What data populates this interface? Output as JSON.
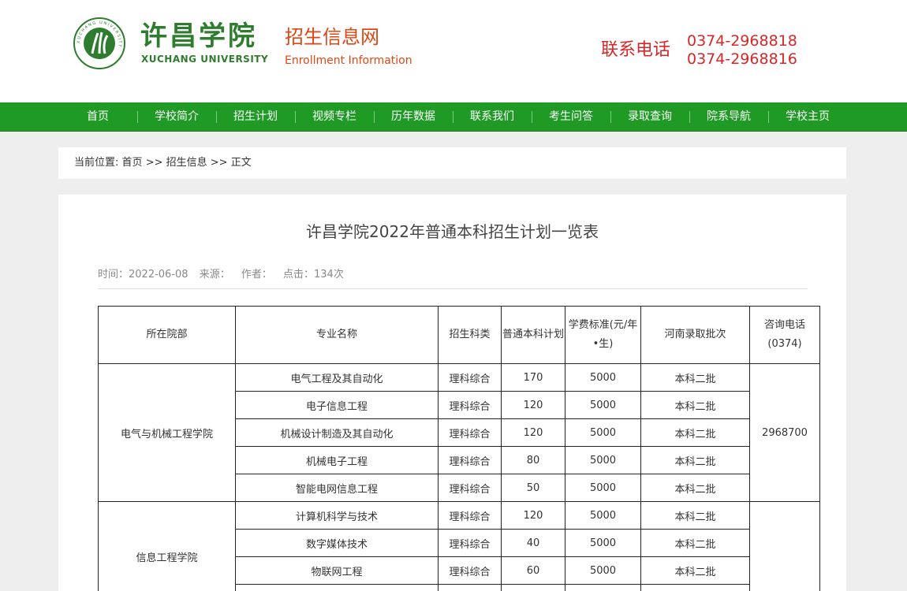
{
  "header": {
    "school_name_cn": "许昌学院",
    "school_name_en": "XUCHANG UNIVERSITY",
    "seal_text": "XUCHANG UNIVERSITY",
    "site_name_cn": "招生信息网",
    "site_name_en": "Enrollment Information",
    "contact_label": "联系电话",
    "phones": [
      "0374-2968818",
      "0374-2968816"
    ]
  },
  "nav": {
    "items": [
      "首页",
      "学校简介",
      "招生计划",
      "视频专栏",
      "历年数据",
      "联系我们",
      "考生问答",
      "录取查询",
      "院系导航",
      "学校主页"
    ]
  },
  "breadcrumb": {
    "prefix": "当前位置:",
    "items": [
      "首页",
      "招生信息",
      "正文"
    ],
    "separator": ">>"
  },
  "article": {
    "title": "许昌学院2022年普通本科招生计划一览表",
    "meta": {
      "time": "时间：2022-06-08",
      "source": "来源：",
      "author": "作者：",
      "clicks": "点击：134次"
    }
  },
  "table": {
    "headers": [
      "所在院部",
      "专业名称",
      "招生科类",
      "普通本科计划",
      "学费标准(元/年•生)",
      "河南录取批次",
      "咨询电话(0374)"
    ],
    "groups": [
      {
        "department": "电气与机械工程学院",
        "phone": "2968700",
        "rows": [
          [
            "电气工程及其自动化",
            "理科综合",
            "170",
            "5000",
            "本科二批"
          ],
          [
            "电子信息工程",
            "理科综合",
            "120",
            "5000",
            "本科二批"
          ],
          [
            "机械设计制造及其自动化",
            "理科综合",
            "120",
            "5000",
            "本科二批"
          ],
          [
            "机械电子工程",
            "理科综合",
            "80",
            "5000",
            "本科二批"
          ],
          [
            "智能电网信息工程",
            "理科综合",
            "50",
            "5000",
            "本科二批"
          ]
        ]
      },
      {
        "department": "信息工程学院",
        "phone": "",
        "rows": [
          [
            "计算机科学与技术",
            "理科综合",
            "120",
            "5000",
            "本科二批"
          ],
          [
            "数字媒体技术",
            "理科综合",
            "40",
            "5000",
            "本科二批"
          ],
          [
            "物联网工程",
            "理科综合",
            "60",
            "5000",
            "本科二批"
          ]
        ]
      }
    ]
  },
  "colors": {
    "nav_green": "#1f9a25",
    "brand_green": "#2e7d2f",
    "accent_orange": "#e04614",
    "contact_red": "#d62828"
  }
}
